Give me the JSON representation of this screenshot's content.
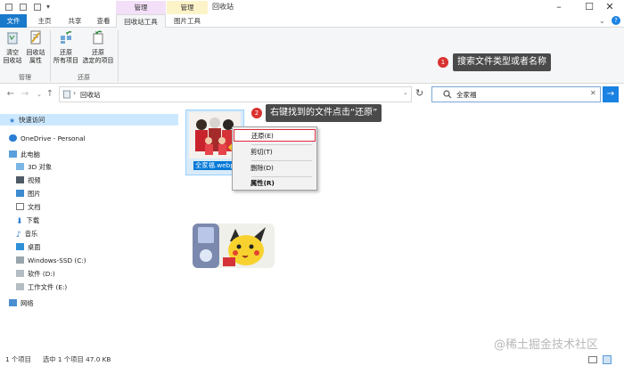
{
  "window": {
    "title": "回收站"
  },
  "contextual_tabs": {
    "manage_recycle": "管理",
    "manage_picture": "管理"
  },
  "ribbon_tabs": {
    "file": "文件",
    "home": "主页",
    "share": "共享",
    "view": "查看",
    "recycle_tools": "回收站工具",
    "picture_tools": "图片工具"
  },
  "ribbon": {
    "empty_recycle": "清空\n回收站",
    "recycle_properties": "回收站\n属性",
    "restore_all": "还原\n所有项目",
    "restore_selected": "还原\n选定的项目",
    "group_manage": "管理",
    "group_restore": "还原"
  },
  "address": {
    "path": "回收站"
  },
  "search": {
    "value": "全家福"
  },
  "nav": {
    "quick_access": "快速访问",
    "onedrive": "OneDrive - Personal",
    "this_pc": "此电脑",
    "objects3d": "3D 对象",
    "video": "视频",
    "pictures": "图片",
    "documents": "文档",
    "downloads": "下载",
    "music": "音乐",
    "desktop": "桌面",
    "drive_c": "Windows-SSD (C:)",
    "drive_d": "软件 (D:)",
    "drive_e": "工作文件 (E:)",
    "network": "网络"
  },
  "files": {
    "file1_name": "全家福.webp"
  },
  "context_menu": {
    "restore": "还原(E)",
    "cut": "剪切(T)",
    "delete": "删除(D)",
    "properties": "属性(R)"
  },
  "callouts": {
    "step1_num": "1",
    "step1_text": "搜索文件类型或者名称",
    "step2_num": "2",
    "step2_text": "右键找到的文件点击“还原”"
  },
  "statusbar": {
    "count": "1 个项目",
    "selected": "选中 1 个项目  47.0 KB"
  },
  "watermark": "@稀土掘金技术社区",
  "colors": {
    "accent": "#0078d7",
    "file_tab": "#1979ca",
    "recycle_tab": "#f3e0f8",
    "picture_tab": "#fdf3c8",
    "badge": "#d9312f",
    "highlight": "#e0263a"
  }
}
